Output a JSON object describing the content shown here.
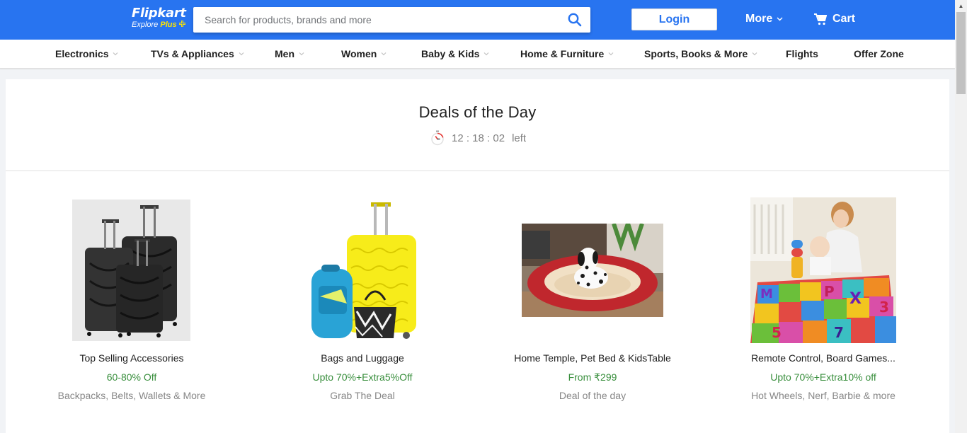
{
  "header": {
    "logo_text": "Flipkart",
    "logo_sub": "Explore",
    "logo_plus": "Plus",
    "search_placeholder": "Search for products, brands and more",
    "login_label": "Login",
    "more_label": "More",
    "cart_label": "Cart"
  },
  "categories": [
    {
      "label": "Electronics",
      "chevron": true
    },
    {
      "label": "TVs & Appliances",
      "chevron": true
    },
    {
      "label": "Men",
      "chevron": true
    },
    {
      "label": "Women",
      "chevron": true
    },
    {
      "label": "Baby & Kids",
      "chevron": true
    },
    {
      "label": "Home & Furniture",
      "chevron": true
    },
    {
      "label": "Sports, Books & More",
      "chevron": true
    },
    {
      "label": "Flights",
      "chevron": false
    },
    {
      "label": "Offer Zone",
      "chevron": false
    }
  ],
  "deals": {
    "title": "Deals of the Day",
    "timer": "12 : 18 : 02",
    "timer_suffix": "left",
    "cards": [
      {
        "name": "Top Selling Accessories",
        "offer": "60-80% Off",
        "tag": "Backpacks, Belts, Wallets & More",
        "image": "black-suitcases-image"
      },
      {
        "name": "Bags and Luggage",
        "offer": "Upto 70%+Extra5%Off",
        "tag": "Grab The Deal",
        "image": "yellow-luggage-image"
      },
      {
        "name": "Home Temple, Pet Bed & KidsTable",
        "offer": "From ₹299",
        "tag": "Deal of the day",
        "image": "pet-bed-image"
      },
      {
        "name": "Remote Control, Board Games...",
        "offer": "Upto 70%+Extra10% off",
        "tag": "Hot Wheels, Nerf, Barbie & more",
        "image": "play-mat-image"
      }
    ]
  },
  "colors": {
    "brand_blue": "#2874f0",
    "logo_yellow": "#ffe500",
    "offer_green": "#388e3c",
    "muted_gray": "#878787",
    "page_bg": "#f1f3f6"
  },
  "icons": [
    "search-icon",
    "chevron-down-icon",
    "cart-icon",
    "stopwatch-icon",
    "plus-icon"
  ]
}
